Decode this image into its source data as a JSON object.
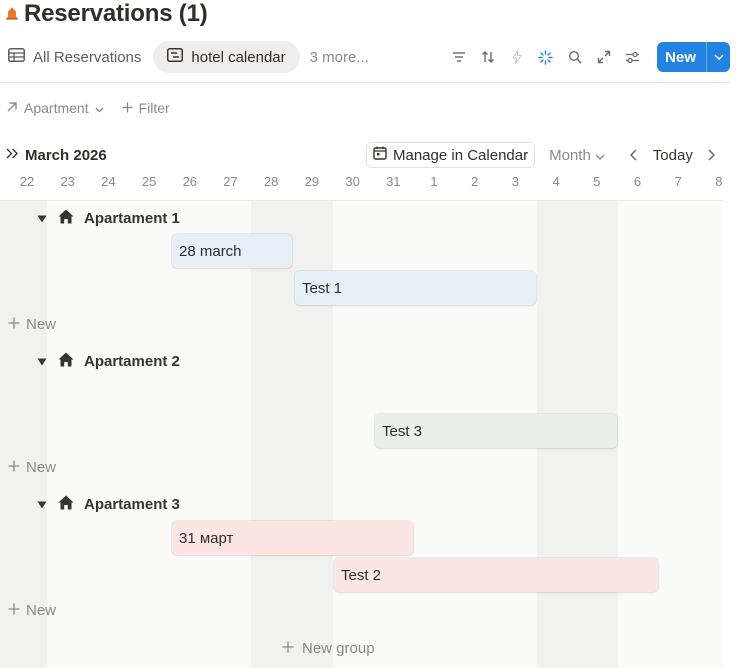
{
  "page": {
    "title": "Reservations (1)",
    "icon": "bell-icon",
    "icon_color": "#e8792b"
  },
  "views": {
    "tabs": [
      {
        "label": "All Reservations",
        "icon": "table-icon"
      },
      {
        "label": "hotel calendar",
        "icon": "timeline-icon",
        "active": true
      }
    ],
    "more_label": "3 more..."
  },
  "toolbar": {
    "icons": [
      "filter-icon",
      "sort-icon",
      "automation-icon",
      "ai-sparkle-icon",
      "search-icon",
      "expand-icon",
      "settings-icon"
    ],
    "new_label": "New",
    "accent": "#2383e2"
  },
  "filters": {
    "group_by_label": "Apartment",
    "filter_label": "Filter"
  },
  "calendar": {
    "month_label": "March 2026",
    "manage_label": "Manage in Calendar",
    "view_select": "Month",
    "today_label": "Today",
    "days": [
      "22",
      "23",
      "24",
      "25",
      "26",
      "27",
      "28",
      "29",
      "30",
      "31",
      "1",
      "2",
      "3",
      "4",
      "5",
      "6",
      "7",
      "8"
    ]
  },
  "groups": [
    {
      "name": "Apartament 1",
      "icon": "home-icon",
      "new_label": "New",
      "events": [
        {
          "title": "28 march",
          "color": "blue"
        },
        {
          "title": "Test 1",
          "color": "blue"
        }
      ]
    },
    {
      "name": "Apartament 2",
      "icon": "home-icon",
      "new_label": "New",
      "events": [
        {
          "title": "Test 3",
          "color": "green"
        }
      ]
    },
    {
      "name": "Apartament 3",
      "icon": "home-icon",
      "new_label": "New",
      "events": [
        {
          "title": "31 март",
          "color": "red"
        },
        {
          "title": "Test 2",
          "color": "red"
        }
      ]
    }
  ],
  "new_group_label": "New group",
  "colors": {
    "event_blue": "#e7f0f9",
    "event_green": "#e9efea",
    "event_red": "#fbe6e4",
    "weekend_shade": "#f1f1ef"
  }
}
